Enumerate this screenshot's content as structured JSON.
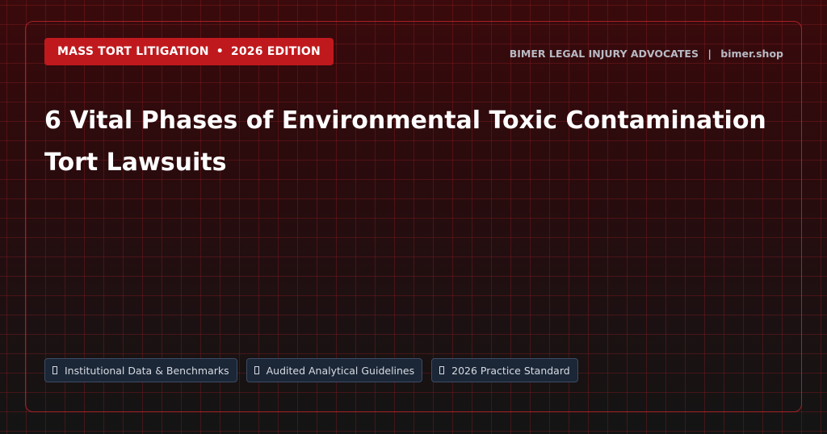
{
  "header": {
    "badge": {
      "category": "MASS TORT LITIGATION",
      "separator": "•",
      "edition": "2026 EDITION"
    },
    "brand": {
      "name": "BIMER LEGAL INJURY ADVOCATES",
      "separator": "|",
      "site": "bimer.shop"
    }
  },
  "main": {
    "title": "6 Vital Phases of Environmental Toxic Contamination Tort Lawsuits"
  },
  "footer": {
    "chips": [
      {
        "icon": "missing-glyph-icon",
        "label": "Institutional Data & Benchmarks"
      },
      {
        "icon": "missing-glyph-icon",
        "label": "Audited Analytical Guidelines"
      },
      {
        "icon": "missing-glyph-icon",
        "label": "2026 Practice Standard"
      }
    ]
  },
  "colors": {
    "accent": "#c0191d",
    "frame_border": "#c8282d",
    "chip_bg": "#1b2636",
    "chip_border": "#3c4c64",
    "brand_text": "#b8bac4"
  }
}
